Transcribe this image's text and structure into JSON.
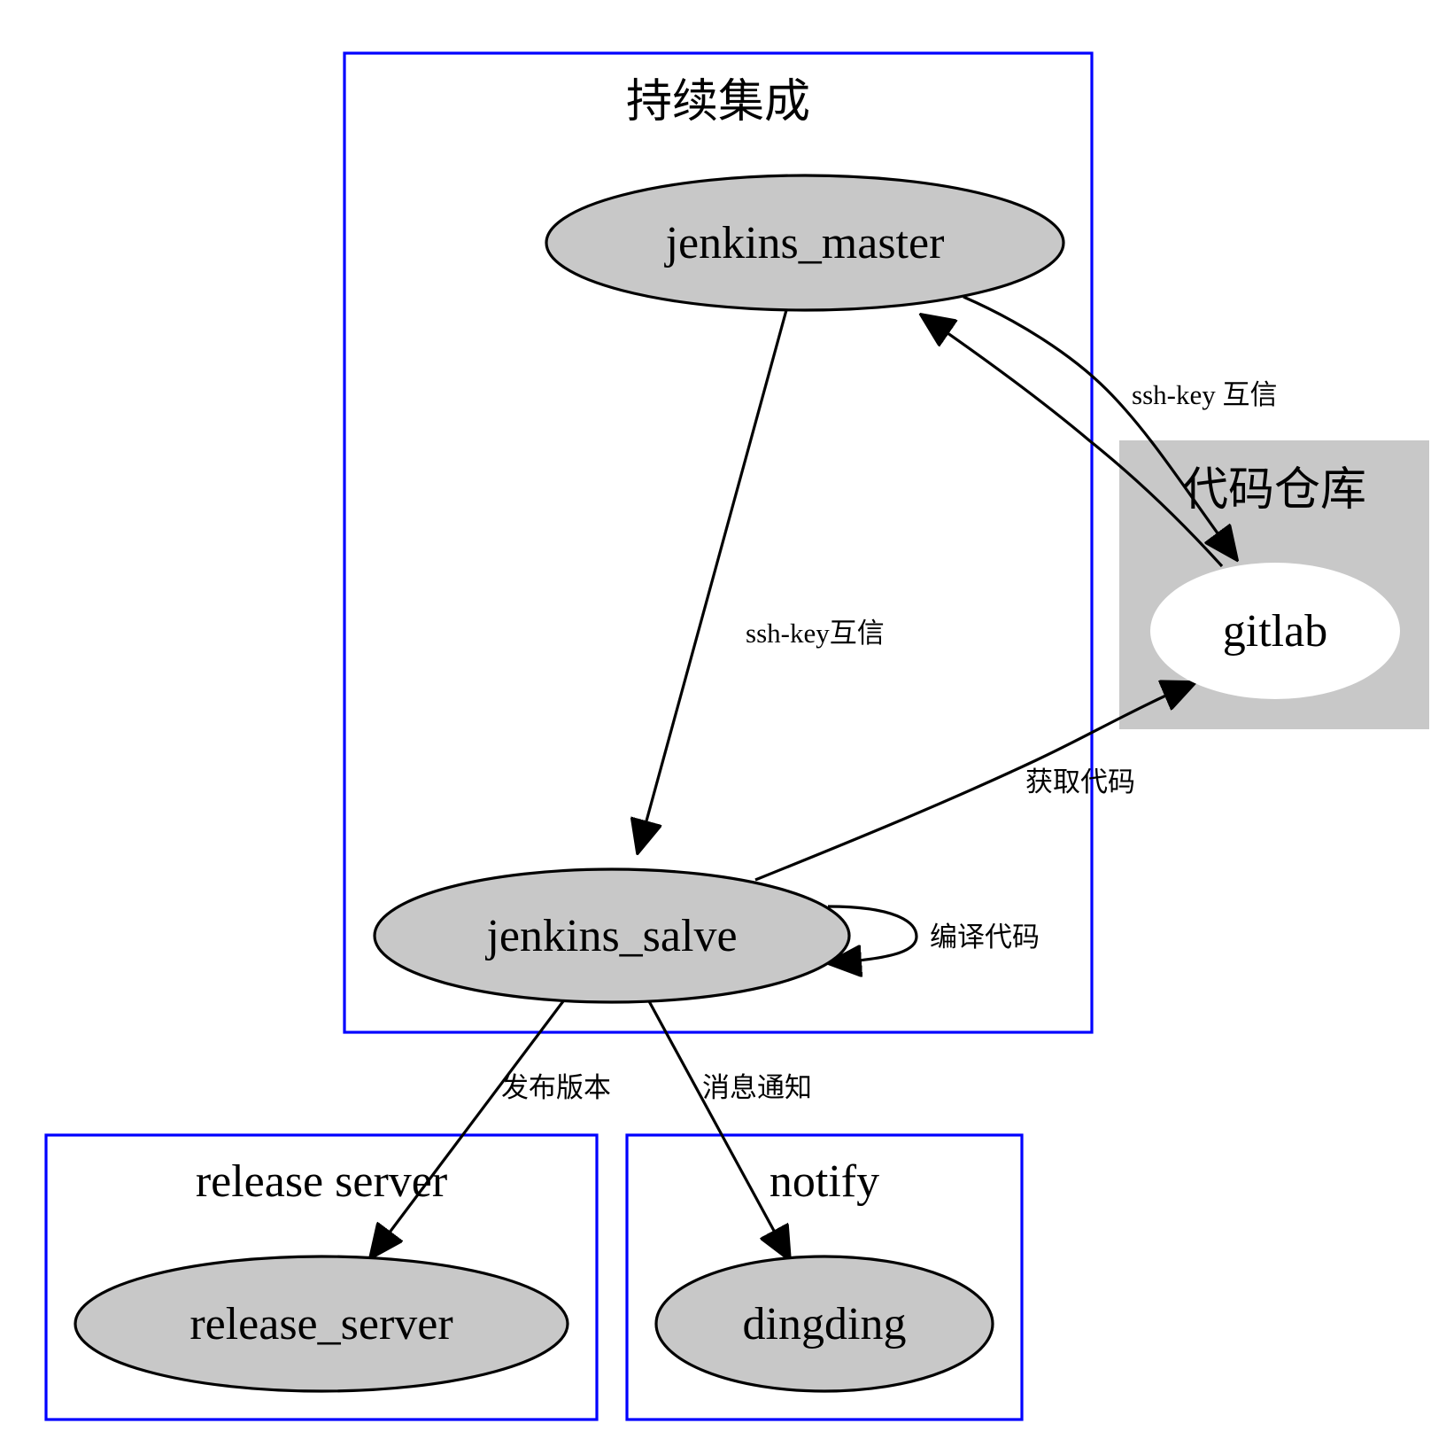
{
  "colors": {
    "cluster_border": "#0000ff",
    "node_fill": "#c8c8c8",
    "repo_cluster_fill": "#c8c8c8",
    "repo_node_fill": "#ffffff",
    "edge": "#000000"
  },
  "clusters": {
    "ci": {
      "label": "持续集成"
    },
    "repo": {
      "label": "代码仓库"
    },
    "release": {
      "label": "release server"
    },
    "notify": {
      "label": "notify"
    }
  },
  "nodes": {
    "jenkins_master": {
      "label": "jenkins_master"
    },
    "jenkins_salve": {
      "label": "jenkins_salve"
    },
    "gitlab": {
      "label": "gitlab"
    },
    "release_server": {
      "label": "release_server"
    },
    "dingding": {
      "label": "dingding"
    }
  },
  "edges": {
    "master_to_salve": {
      "from": "jenkins_master",
      "to": "jenkins_salve",
      "label": "ssh-key互信"
    },
    "master_to_gitlab": {
      "from": "jenkins_master",
      "to": "gitlab",
      "label": "ssh-key 互信"
    },
    "gitlab_to_master": {
      "from": "gitlab",
      "to": "jenkins_master",
      "label": ""
    },
    "salve_to_gitlab": {
      "from": "jenkins_salve",
      "to": "gitlab",
      "label": "获取代码"
    },
    "salve_self": {
      "from": "jenkins_salve",
      "to": "jenkins_salve",
      "label": "编译代码"
    },
    "salve_to_release": {
      "from": "jenkins_salve",
      "to": "release_server",
      "label": "发布版本"
    },
    "salve_to_dingding": {
      "from": "jenkins_salve",
      "to": "dingding",
      "label": "消息通知"
    }
  }
}
